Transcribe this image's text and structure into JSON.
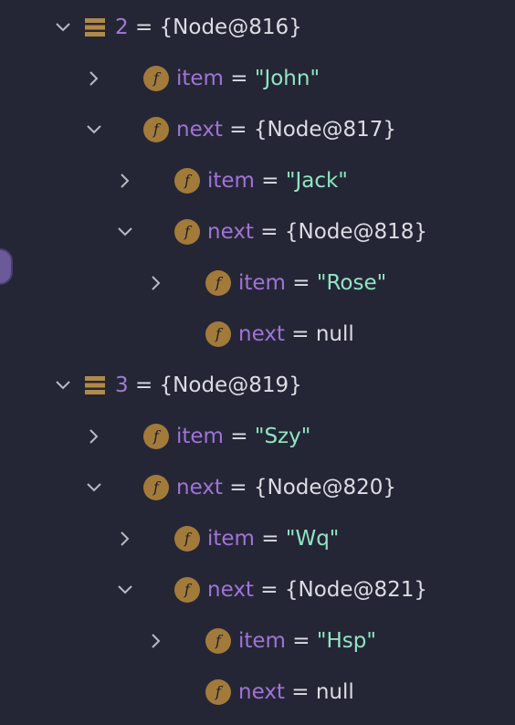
{
  "rows": [
    {
      "indent": 0,
      "toggle": "expanded",
      "icon": "array-icon",
      "name": "2",
      "is_index": true,
      "eq": " = ",
      "value": "{Node@816}",
      "vtype": "obj"
    },
    {
      "indent": 1,
      "toggle": "collapsed",
      "icon": "field-icon",
      "name": "item",
      "eq": " = ",
      "value": "\"John\"",
      "vtype": "str"
    },
    {
      "indent": 1,
      "toggle": "expanded",
      "icon": "field-icon",
      "name": "next",
      "eq": " = ",
      "value": "{Node@817}",
      "vtype": "obj"
    },
    {
      "indent": 2,
      "toggle": "collapsed",
      "icon": "field-icon",
      "name": "item",
      "eq": " = ",
      "value": "\"Jack\"",
      "vtype": "str"
    },
    {
      "indent": 2,
      "toggle": "expanded",
      "icon": "field-icon",
      "name": "next",
      "eq": " = ",
      "value": "{Node@818}",
      "vtype": "obj"
    },
    {
      "indent": 3,
      "toggle": "collapsed",
      "icon": "field-icon",
      "name": "item",
      "eq": " = ",
      "value": "\"Rose\"",
      "vtype": "str"
    },
    {
      "indent": 3,
      "toggle": "none",
      "icon": "field-icon",
      "name": "next",
      "eq": " = ",
      "value": "null",
      "vtype": "null"
    },
    {
      "indent": 0,
      "toggle": "expanded",
      "icon": "array-icon",
      "name": "3",
      "is_index": true,
      "eq": " = ",
      "value": "{Node@819}",
      "vtype": "obj"
    },
    {
      "indent": 1,
      "toggle": "collapsed",
      "icon": "field-icon",
      "name": "item",
      "eq": " = ",
      "value": "\"Szy\"",
      "vtype": "str"
    },
    {
      "indent": 1,
      "toggle": "expanded",
      "icon": "field-icon",
      "name": "next",
      "eq": " = ",
      "value": "{Node@820}",
      "vtype": "obj"
    },
    {
      "indent": 2,
      "toggle": "collapsed",
      "icon": "field-icon",
      "name": "item",
      "eq": " = ",
      "value": "\"Wq\"",
      "vtype": "str"
    },
    {
      "indent": 2,
      "toggle": "expanded",
      "icon": "field-icon",
      "name": "next",
      "eq": " = ",
      "value": "{Node@821}",
      "vtype": "obj"
    },
    {
      "indent": 3,
      "toggle": "collapsed",
      "icon": "field-icon",
      "name": "item",
      "eq": " = ",
      "value": "\"Hsp\"",
      "vtype": "str"
    },
    {
      "indent": 3,
      "toggle": "none",
      "icon": "field-icon",
      "name": "next",
      "eq": " = ",
      "value": "null",
      "vtype": "null"
    }
  ],
  "field_icon_glyph": "f",
  "colors": {
    "background": "#252635",
    "name": "#9f74d6",
    "string": "#8fe6c4",
    "field_icon": "#a27a3a",
    "array_icon": "#b08a4a"
  }
}
